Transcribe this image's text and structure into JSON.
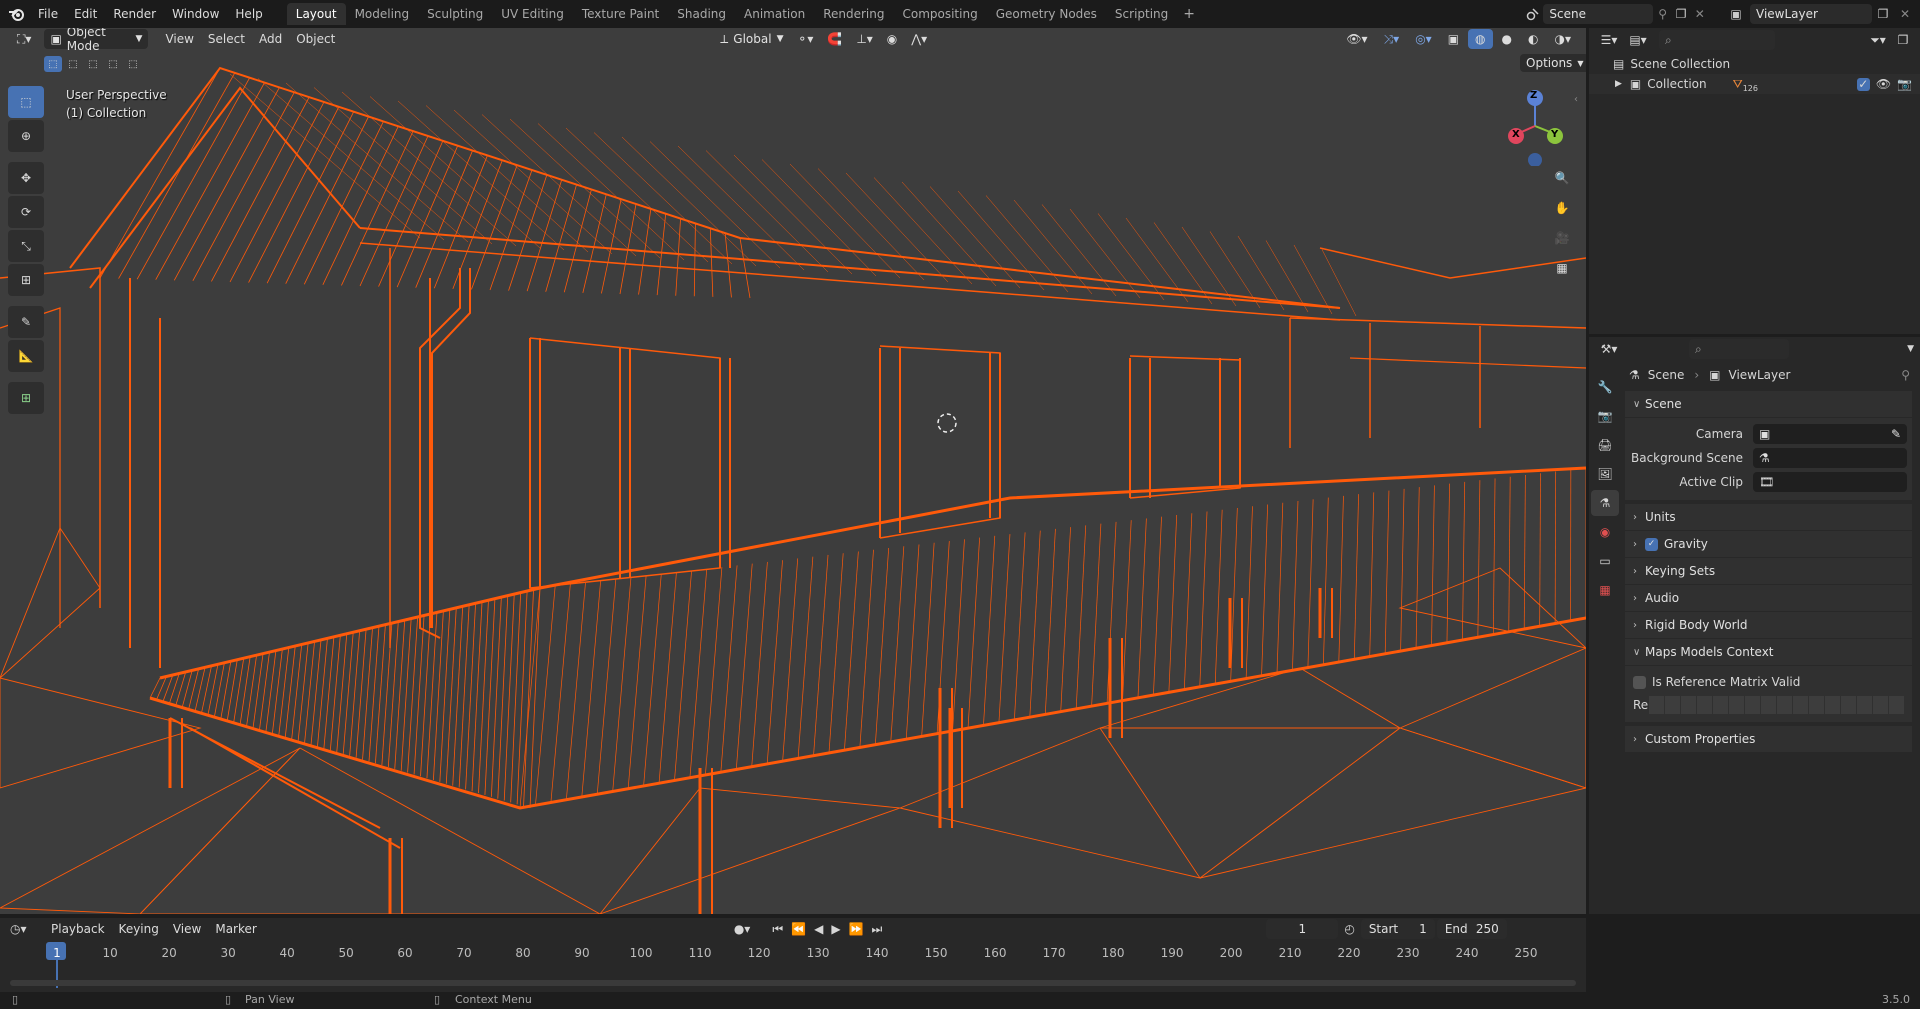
{
  "topbar": {
    "menus": [
      "File",
      "Edit",
      "Render",
      "Window",
      "Help"
    ],
    "workspaces": [
      "Layout",
      "Modeling",
      "Sculpting",
      "UV Editing",
      "Texture Paint",
      "Shading",
      "Animation",
      "Rendering",
      "Compositing",
      "Geometry Nodes",
      "Scripting"
    ],
    "active_workspace": "Layout",
    "add_tab": "+",
    "scene_name": "Scene",
    "view_layer_name": "ViewLayer"
  },
  "viewport": {
    "mode": "Object Mode",
    "menus": [
      "View",
      "Select",
      "Add",
      "Object"
    ],
    "orientation": "Global",
    "options_label": "Options",
    "perspective_label": "User Perspective",
    "collection_label": "(1) Collection",
    "gizmo": {
      "x": "X",
      "y": "Y",
      "z": "Z"
    },
    "wire_color": "#ff5a0a",
    "bg_color": "#3d3d3d"
  },
  "outliner": {
    "root": "Scene Collection",
    "child": "Collection",
    "child_count": "126"
  },
  "properties": {
    "breadcrumb_scene": "Scene",
    "breadcrumb_layer": "ViewLayer",
    "scene_panel": "Scene",
    "camera_label": "Camera",
    "background_label": "Background Scene",
    "active_clip_label": "Active Clip",
    "panels": [
      "Units",
      "Gravity",
      "Keying Sets",
      "Audio",
      "Rigid Body World"
    ],
    "maps_panel": "Maps Models Context",
    "ref_matrix_label": "Is Reference Matrix Valid",
    "re_label": "Re",
    "custom_props": "Custom Properties"
  },
  "timeline": {
    "menus": [
      "Playback",
      "Keying",
      "View",
      "Marker"
    ],
    "current_frame": "1",
    "start_label": "Start",
    "start_value": "1",
    "end_label": "End",
    "end_value": "250",
    "ticks": [
      "1",
      "10",
      "20",
      "30",
      "40",
      "50",
      "60",
      "70",
      "80",
      "90",
      "100",
      "110",
      "120",
      "130",
      "140",
      "150",
      "160",
      "170",
      "180",
      "190",
      "200",
      "210",
      "220",
      "230",
      "240",
      "250"
    ]
  },
  "statusbar": {
    "pan": "Pan View",
    "context": "Context Menu",
    "version": "3.5.0"
  }
}
